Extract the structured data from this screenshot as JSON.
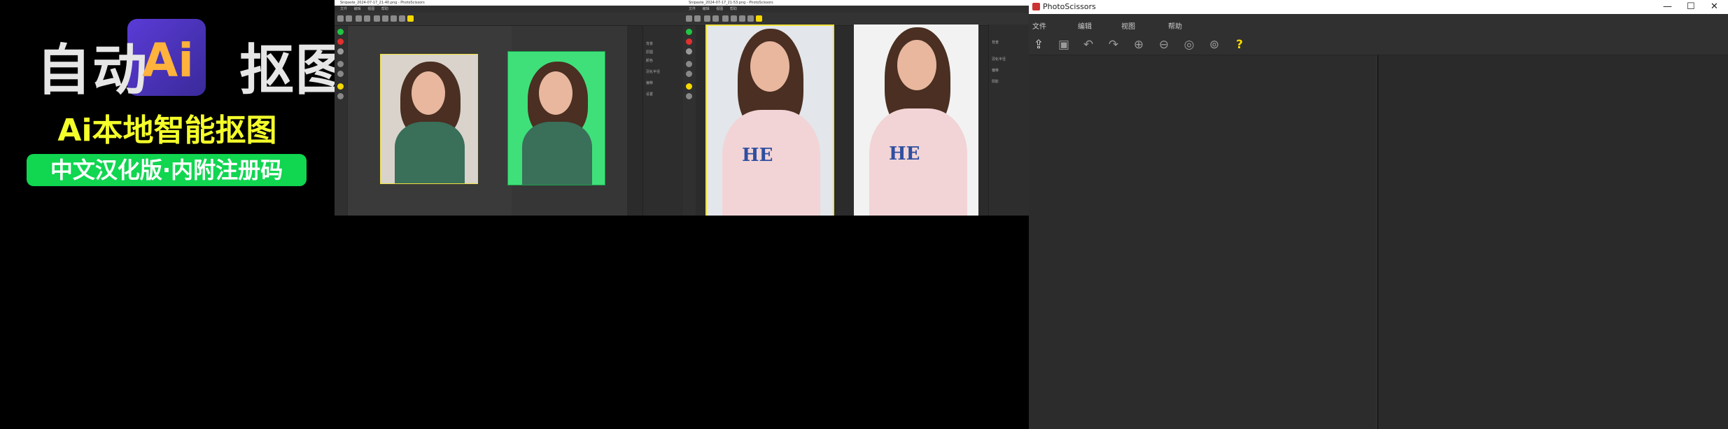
{
  "promo": {
    "title_left": "自动",
    "badge_text": "Ai",
    "title_right": "抠图",
    "subtitle": "Ai本地智能抠图",
    "pill_text": "中文汉化版·内附注册码"
  },
  "window1": {
    "title": "Snipaste_2024-07-17_21-40.png - PhotoScissors",
    "menu": [
      "文件",
      "编辑",
      "视图",
      "帮助"
    ],
    "panel_labels": [
      "背景",
      "原图",
      "颜色",
      "羽化半径",
      "偏移",
      "设置"
    ]
  },
  "window2": {
    "title": "Snipaste_2024-07-17_21-53.png - PhotoScissors",
    "menu": [
      "文件",
      "编辑",
      "视图",
      "帮助"
    ],
    "panel_labels": [
      "背景",
      "羽化半径",
      "偏移",
      "阴影"
    ]
  },
  "main_window": {
    "title": "PhotoScissors",
    "menu": [
      "文件",
      "编辑",
      "视图",
      "帮助"
    ],
    "toolbar_icons": [
      "open-icon",
      "save-icon",
      "undo-icon",
      "redo-icon",
      "zoom-in-icon",
      "zoom-out-icon",
      "zoom-actual-icon",
      "zoom-fit-icon",
      "help-icon"
    ],
    "help_glyph": "?"
  },
  "colors": {
    "keep_marker": "#22c443",
    "remove_marker": "#e03030",
    "outline_yellow": "#f0e23a",
    "green_bg": "#3fe07a",
    "help_yellow": "#f5d800"
  }
}
